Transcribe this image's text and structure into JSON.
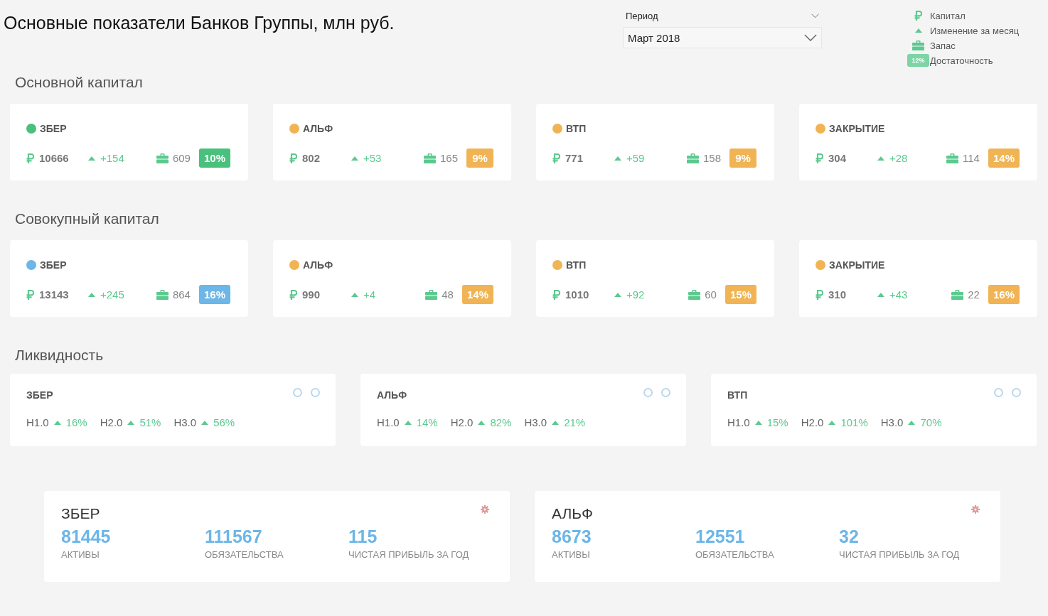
{
  "title": "Основные показатели Банков Группы, млн руб.",
  "period": {
    "label": "Период",
    "value": "Март 2018"
  },
  "legend": [
    {
      "kind": "ruble",
      "label": "Капитал"
    },
    {
      "kind": "arrow",
      "label": "Изменение за месяц"
    },
    {
      "kind": "briefcase",
      "label": "Запас"
    },
    {
      "kind": "badge",
      "badge": "12%",
      "label": "Достаточность"
    }
  ],
  "sections": [
    {
      "title": "Основной капитал",
      "cards": [
        {
          "name": "ЗБЕР",
          "color": "#49c07c",
          "capital": "10666",
          "change": "+154",
          "reserve": "609",
          "adequacy": "10%"
        },
        {
          "name": "АЛЬФ",
          "color": "#f0b454",
          "capital": "802",
          "change": "+53",
          "reserve": "165",
          "adequacy": "9%"
        },
        {
          "name": "ВТП",
          "color": "#f0b454",
          "capital": "771",
          "change": "+59",
          "reserve": "158",
          "adequacy": "9%"
        },
        {
          "name": "ЗАКРЫТИЕ",
          "color": "#f0b454",
          "capital": "304",
          "change": "+28",
          "reserve": "114",
          "adequacy": "14%"
        }
      ]
    },
    {
      "title": "Совокупный капитал",
      "cards": [
        {
          "name": "ЗБЕР",
          "color": "#6cb6e8",
          "capital": "13143",
          "change": "+245",
          "reserve": "864",
          "adequacy": "16%"
        },
        {
          "name": "АЛЬФ",
          "color": "#f0b454",
          "capital": "990",
          "change": "+4",
          "reserve": "48",
          "adequacy": "14%"
        },
        {
          "name": "ВТП",
          "color": "#f0b454",
          "capital": "1010",
          "change": "+92",
          "reserve": "60",
          "adequacy": "15%"
        },
        {
          "name": "ЗАКРЫТИЕ",
          "color": "#f0b454",
          "capital": "310",
          "change": "+43",
          "reserve": "22",
          "adequacy": "16%"
        }
      ]
    }
  ],
  "liquidity": {
    "title": "Ликвидность",
    "cards": [
      {
        "name": "ЗБЕР",
        "metrics": [
          {
            "label": "Н1.0",
            "value": "16%"
          },
          {
            "label": "Н2.0",
            "value": "51%"
          },
          {
            "label": "Н3.0",
            "value": "56%"
          }
        ]
      },
      {
        "name": "АЛЬФ",
        "metrics": [
          {
            "label": "Н1.0",
            "value": "14%"
          },
          {
            "label": "Н2.0",
            "value": "82%"
          },
          {
            "label": "Н3.0",
            "value": "21%"
          }
        ]
      },
      {
        "name": "ВТП",
        "metrics": [
          {
            "label": "Н1.0",
            "value": "15%"
          },
          {
            "label": "Н2.0",
            "value": "101%"
          },
          {
            "label": "Н3.0",
            "value": "70%"
          }
        ]
      }
    ]
  },
  "summary": [
    {
      "name": "ЗБЕР",
      "stats": [
        {
          "value": "81445",
          "label": "АКТИВЫ"
        },
        {
          "value": "111567",
          "label": "ОБЯЗАТЕЛЬСТВА"
        },
        {
          "value": "115",
          "label": "ЧИСТАЯ ПРИБЫЛЬ ЗА ГОД"
        }
      ]
    },
    {
      "name": "АЛЬФ",
      "stats": [
        {
          "value": "8673",
          "label": "АКТИВЫ"
        },
        {
          "value": "12551",
          "label": "ОБЯЗАТЕЛЬСТВА"
        },
        {
          "value": "32",
          "label": "ЧИСТАЯ ПРИБЫЛЬ ЗА ГОД"
        }
      ]
    }
  ]
}
